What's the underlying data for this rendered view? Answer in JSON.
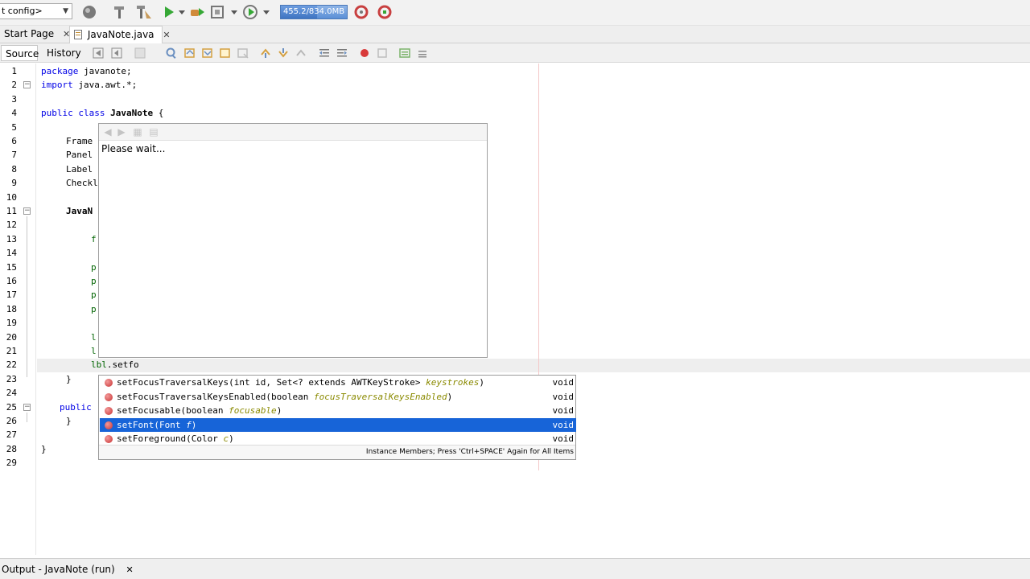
{
  "toolbar": {
    "config_value": "t config>",
    "memory_text": "455.2/834.0MB",
    "memory_fraction": 0.55
  },
  "tabs": [
    {
      "label": "Start Page",
      "active": false
    },
    {
      "label": "JavaNote.java",
      "active": true
    }
  ],
  "views": {
    "source": "Source",
    "history": "History"
  },
  "editor": {
    "line_numbers": [
      "1",
      "2",
      "3",
      "4",
      "5",
      "6",
      "7",
      "8",
      "9",
      "10",
      "11",
      "12",
      "13",
      "14",
      "15",
      "16",
      "17",
      "18",
      "19",
      "20",
      "21",
      "22",
      "23",
      "24",
      "25",
      "26",
      "27",
      "28",
      "29"
    ],
    "lines": {
      "l1_kw": "package",
      "l1_rest": " javanote;",
      "l2_kw": "import",
      "l2_rest": " java.awt.*;",
      "l4_kw": "public class",
      "l4_name": "JavaNote",
      "l4_rest": " {",
      "l6": "Frame",
      "l7": "Panel",
      "l8": "Label",
      "l9": "Checkl",
      "l11": "JavaN",
      "l13": "f",
      "l15": "p",
      "l16": "p",
      "l17": "p",
      "l18": "p",
      "l20": "l",
      "l21": "l",
      "l22_obj": "lbl",
      "l22_rest": ".setfo",
      "l23": "}",
      "l25_kw": "public",
      "l26": "}",
      "l28": "}"
    }
  },
  "doc_popup": {
    "text": "Please wait..."
  },
  "completion": {
    "items": [
      {
        "name": "setFocusTraversalKeys(int id, Set<? extends AWTKeyStroke> ",
        "param": "keystrokes",
        "tail": ")",
        "ret": "void"
      },
      {
        "name": "setFocusTraversalKeysEnabled(boolean ",
        "param": "focusTraversalKeysEnabled",
        "tail": ")",
        "ret": "void"
      },
      {
        "name": "setFocusable(boolean ",
        "param": "focusable",
        "tail": ")",
        "ret": "void"
      },
      {
        "name": "setFont(Font ",
        "param": "f",
        "tail": ")",
        "ret": "void"
      },
      {
        "name": "setForeground(Color ",
        "param": "c",
        "tail": ")",
        "ret": "void"
      }
    ],
    "selected_index": 3,
    "footer": "Instance Members; Press 'Ctrl+SPACE' Again for All Items"
  },
  "output": {
    "label": "Output - JavaNote (run)"
  },
  "colors": {
    "selection": "#1764d8",
    "keyword": "#0000e6",
    "field": "#006400",
    "method_dot": "#c83232"
  }
}
